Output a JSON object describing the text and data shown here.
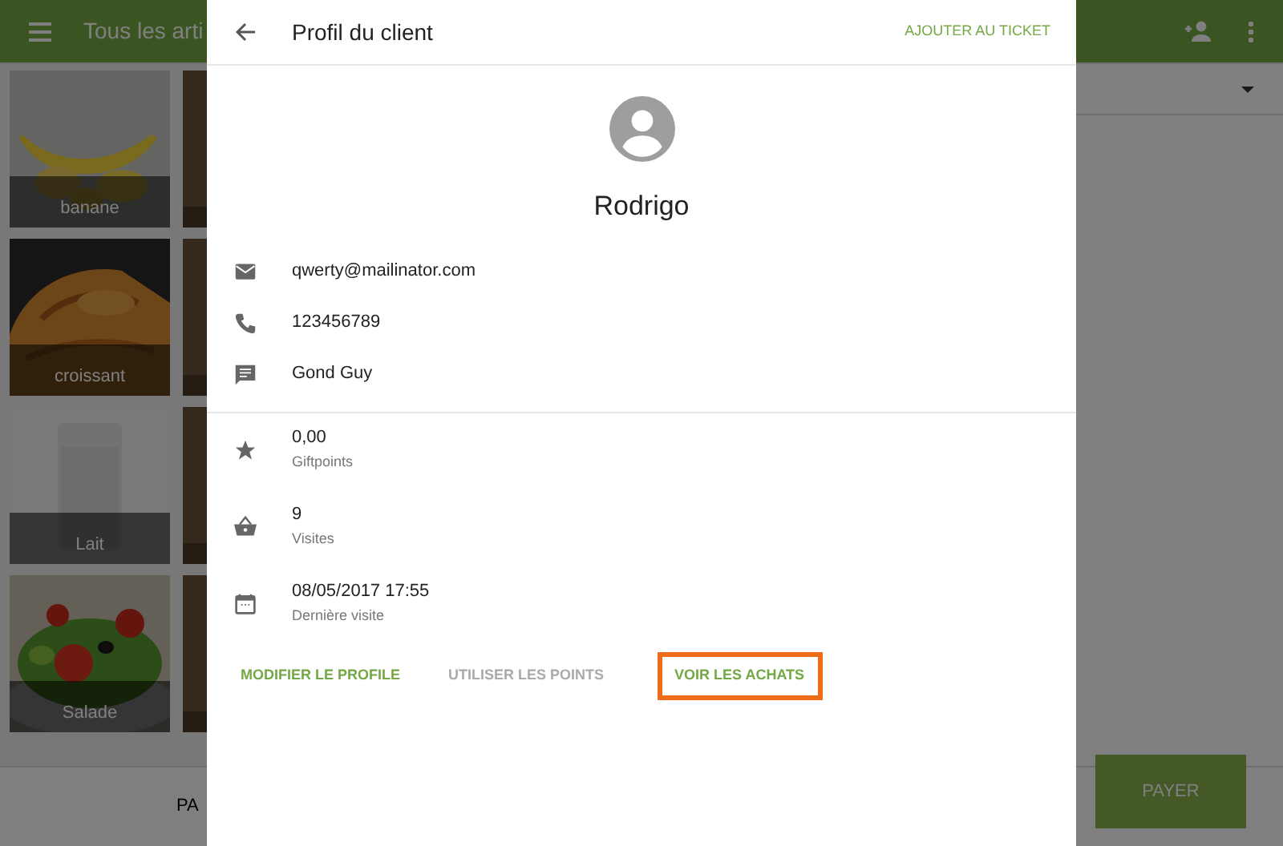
{
  "app_bar": {
    "title": "Tous les arti"
  },
  "products": [
    {
      "label": "banane",
      "kind": "banana"
    },
    {
      "label": "croissant",
      "kind": "croissant"
    },
    {
      "label": "Lait",
      "kind": "milk"
    },
    {
      "label": "Salade",
      "kind": "salad"
    }
  ],
  "bottom_bar": {
    "left_label": "PA",
    "pay_button": "PAYER"
  },
  "dialog": {
    "title": "Profil du client",
    "action": "AJOUTER AU TICKET",
    "customer_name": "Rodrigo",
    "contacts": [
      {
        "kind": "email",
        "value": "qwerty@mailinator.com"
      },
      {
        "kind": "phone",
        "value": "123456789"
      },
      {
        "kind": "note",
        "value": "Gond Guy"
      }
    ],
    "stats": [
      {
        "kind": "points",
        "value": "0,00",
        "caption": "Giftpoints"
      },
      {
        "kind": "visits",
        "value": "9",
        "caption": "Visites"
      },
      {
        "kind": "calendar",
        "value": "08/05/2017 17:55",
        "caption": "Dernière visite"
      }
    ],
    "buttons": [
      {
        "label": "MODIFIER LE PROFILE",
        "disabled": false,
        "highlighted": false
      },
      {
        "label": "UTILISER LES POINTS",
        "disabled": true,
        "highlighted": false
      },
      {
        "label": "VOIR LES ACHATS",
        "disabled": false,
        "highlighted": true
      }
    ]
  }
}
